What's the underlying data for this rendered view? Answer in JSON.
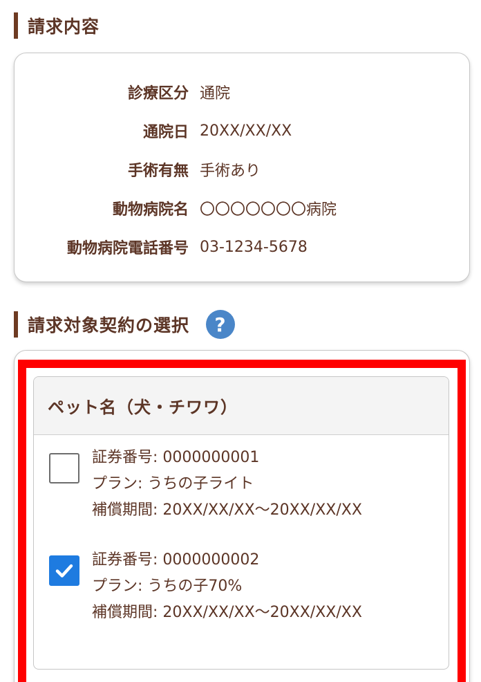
{
  "sections": {
    "billing_title": "請求内容",
    "contract_title": "請求対象契約の選択",
    "help_icon_glyph": "?"
  },
  "billing": {
    "rows": [
      {
        "label": "診療区分",
        "value": "通院"
      },
      {
        "label": "通院日",
        "value": "20XX/XX/XX"
      },
      {
        "label": "手術有無",
        "value": "手術あり"
      },
      {
        "label": "動物病院名",
        "value": "〇〇〇〇〇〇〇病院"
      },
      {
        "label": "動物病院電話番号",
        "value": "03-1234-5678"
      }
    ]
  },
  "pet": {
    "header": "ペット名（犬・チワワ）",
    "contracts": [
      {
        "checked": false,
        "policy": "証券番号: 0000000001",
        "plan": "プラン: うちの子ライト",
        "period": "補償期間: 20XX/XX/XX〜20XX/XX/XX"
      },
      {
        "checked": true,
        "policy": "証券番号: 0000000002",
        "plan": "プラン: うちの子70%",
        "period": "補償期間: 20XX/XX/XX〜20XX/XX/XX"
      }
    ]
  },
  "colors": {
    "text": "#5c3526",
    "accent_bar": "#6e3b22",
    "help_icon": "#4a86c8",
    "checkbox_checked": "#1e7be0",
    "highlight_frame": "#ff0000"
  }
}
